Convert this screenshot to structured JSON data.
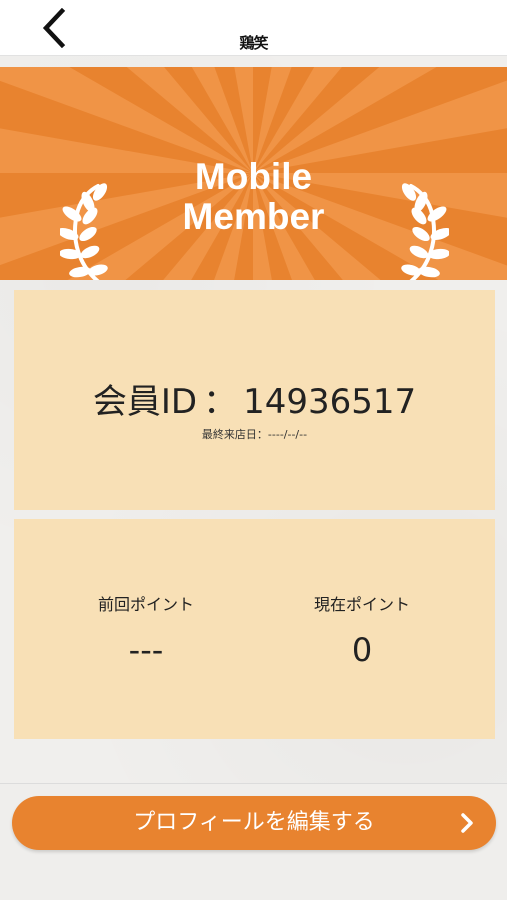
{
  "header": {
    "back_icon": "chevron-left-icon",
    "logo_text": "鶏笑"
  },
  "banner": {
    "title_line1": "Mobile",
    "title_line2": "Member",
    "left_icon": "laurel-icon",
    "right_icon": "laurel-icon",
    "background_color": "#e8832f"
  },
  "member_card": {
    "id_label": "会員ID",
    "id_separator": "：",
    "id_value": "14936517",
    "last_visit_label": "最終来店日：",
    "last_visit_value": "----/--/--",
    "background_color": "#f8e0b6"
  },
  "points_card": {
    "previous_label": "前回ポイント",
    "previous_value": "---",
    "current_label": "現在ポイント",
    "current_value": "0"
  },
  "edit_profile": {
    "label": "プロフィールを編集する",
    "icon": "chevron-right-icon",
    "color": "#e8832f"
  }
}
